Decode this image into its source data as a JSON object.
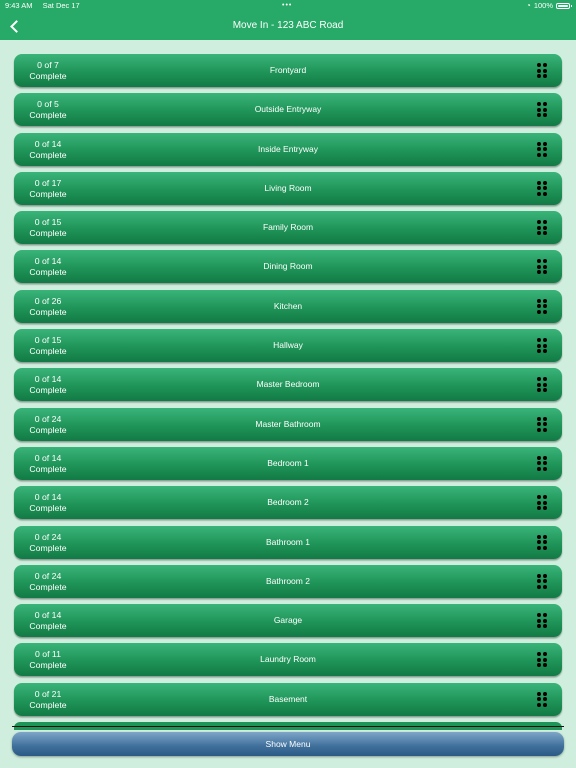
{
  "status": {
    "time": "9:43 AM",
    "date": "Sat Dec 17",
    "battery": "100%"
  },
  "nav": {
    "title": "Move In - 123 ABC Road"
  },
  "rooms": [
    {
      "progress": "0 of 7",
      "status": "Complete",
      "name": "Frontyard"
    },
    {
      "progress": "0 of 5",
      "status": "Complete",
      "name": "Outside Entryway"
    },
    {
      "progress": "0 of 14",
      "status": "Complete",
      "name": "Inside Entryway"
    },
    {
      "progress": "0 of 17",
      "status": "Complete",
      "name": "Living Room"
    },
    {
      "progress": "0 of 15",
      "status": "Complete",
      "name": "Family Room"
    },
    {
      "progress": "0 of 14",
      "status": "Complete",
      "name": "Dining Room"
    },
    {
      "progress": "0 of 26",
      "status": "Complete",
      "name": "Kitchen"
    },
    {
      "progress": "0 of 15",
      "status": "Complete",
      "name": "Hallway"
    },
    {
      "progress": "0 of 14",
      "status": "Complete",
      "name": "Master Bedroom"
    },
    {
      "progress": "0 of 24",
      "status": "Complete",
      "name": "Master Bathroom"
    },
    {
      "progress": "0 of 14",
      "status": "Complete",
      "name": "Bedroom 1"
    },
    {
      "progress": "0 of 14",
      "status": "Complete",
      "name": "Bedroom 2"
    },
    {
      "progress": "0 of 24",
      "status": "Complete",
      "name": "Bathroom 1"
    },
    {
      "progress": "0 of 24",
      "status": "Complete",
      "name": "Bathroom 2"
    },
    {
      "progress": "0 of 14",
      "status": "Complete",
      "name": "Garage"
    },
    {
      "progress": "0 of 11",
      "status": "Complete",
      "name": "Laundry Room"
    },
    {
      "progress": "0 of 21",
      "status": "Complete",
      "name": "Basement"
    }
  ],
  "footer": {
    "show_menu_label": "Show Menu"
  },
  "icons": {
    "back": "chevron-left-icon",
    "reorder": "grip-icon",
    "wifi": "wifi-icon",
    "battery": "battery-icon"
  },
  "colors": {
    "nav_bar": "#27a968",
    "row_top": "#3ab47a",
    "row_bottom": "#127a45",
    "background": "#cfeedd",
    "menu_button": "#3e6f9a"
  }
}
